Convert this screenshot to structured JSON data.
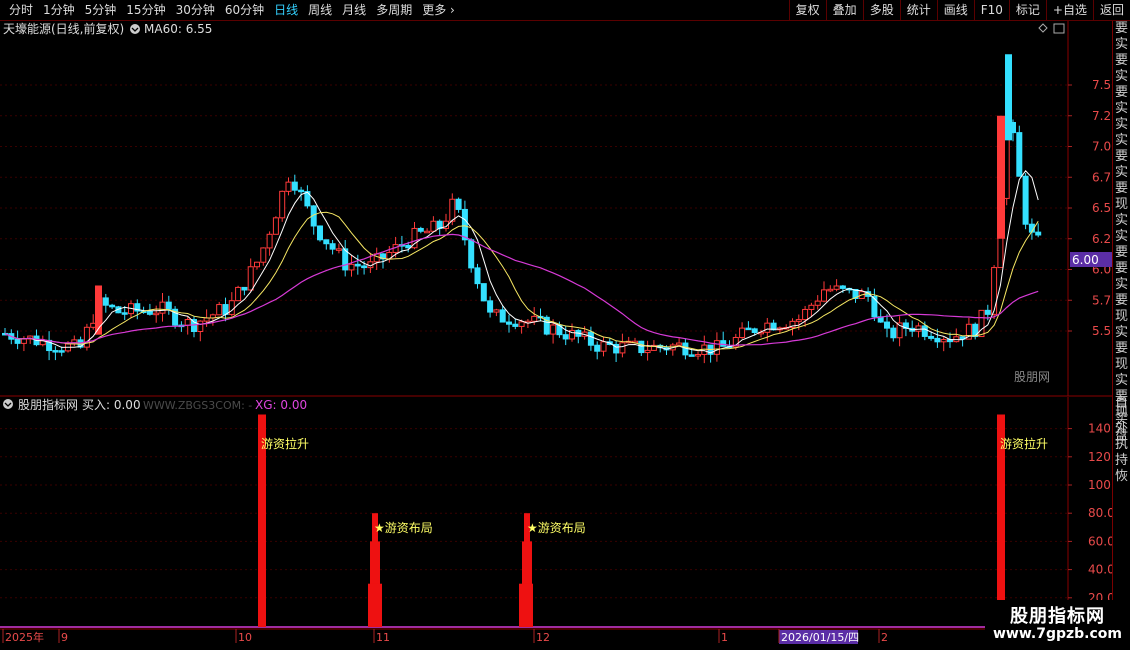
{
  "toolbar": {
    "periods": [
      "分时",
      "1分钟",
      "5分钟",
      "15分钟",
      "30分钟",
      "60分钟",
      "日线",
      "周线",
      "月线",
      "多周期",
      "更多"
    ],
    "active_period": "日线",
    "right_buttons": [
      "复权",
      "叠加",
      "多股",
      "统计",
      "画线",
      "F10",
      "标记",
      "+自选",
      "返回"
    ]
  },
  "main_panel": {
    "stock_title": "天壕能源(日线,前复权)",
    "indicator_label": "MA60: 6.55",
    "watermark": "股朋网",
    "price_ticks": [
      "7.50",
      "7.25",
      "7.00",
      "6.75",
      "6.50",
      "6.25",
      "6.00",
      "5.75",
      "5.50"
    ],
    "current_price_label": "6.00"
  },
  "sub_panel": {
    "title": "股朋指标网",
    "buy_label": "买入: 0.00",
    "site": "WWW.ZBGS3COM: -",
    "xg_label": "XG: 0.00",
    "ticks": [
      "140.0",
      "120.0",
      "100.0",
      "80.00",
      "60.00",
      "40.00",
      "20.00"
    ],
    "signals": [
      "游资拉升",
      "★游资布局",
      "★游资布局",
      "游资拉升"
    ]
  },
  "date_axis": {
    "labels": [
      "2025年",
      "9",
      "10",
      "11",
      "12",
      "1",
      "2026/01/15/四",
      "2"
    ]
  },
  "sidebar": {
    "text_top": "要实要实要实实实要实要现实实要要实要现实要现实要现外执持恢",
    "text_bottom": "自买盘"
  },
  "corner_watermark": {
    "title": "股朋指标网",
    "url": "www.7gpzb.com"
  },
  "colors": {
    "up": "#ff3a3a",
    "down": "#34e0ff",
    "ma_white": "#ffffff",
    "ma_yellow": "#f5e663",
    "ma_magenta": "#d63ad6",
    "signal_text": "#ffff66",
    "active_tab": "#33d1ff"
  }
}
